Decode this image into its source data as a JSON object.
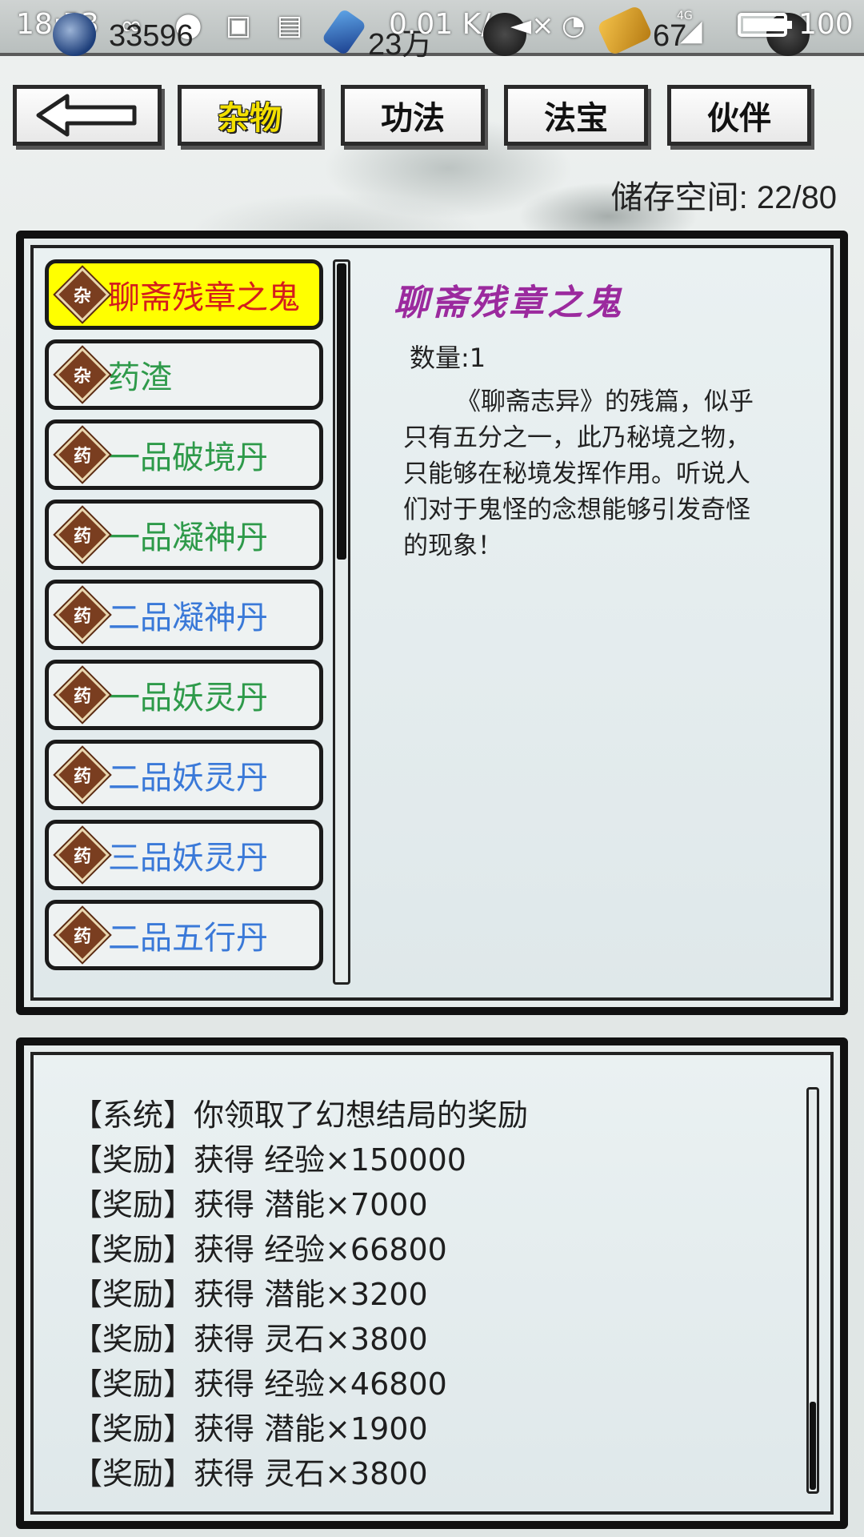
{
  "status_bar": {
    "time": "18:53",
    "speed": "0.01 K/s",
    "battery_level": "100",
    "battery_fill": 1.0,
    "network": "4G"
  },
  "resources": {
    "taiji_value": "33596",
    "crystal_value": "23万",
    "jade_value": "67"
  },
  "tabs": [
    {
      "label": "杂物",
      "active": true
    },
    {
      "label": "功法",
      "active": false
    },
    {
      "label": "法宝",
      "active": false
    },
    {
      "label": "伙伴",
      "active": false
    }
  ],
  "storage": {
    "label": "储存空间: 22/80"
  },
  "items": [
    {
      "badge": "杂",
      "name": "聊斋残章之鬼",
      "color": "#d41d1d",
      "selected": true
    },
    {
      "badge": "杂",
      "name": "药渣",
      "color": "#2e9a4a",
      "selected": false
    },
    {
      "badge": "药",
      "name": "一品破境丹",
      "color": "#2e9a4a",
      "selected": false
    },
    {
      "badge": "药",
      "name": "一品凝神丹",
      "color": "#2e9a4a",
      "selected": false
    },
    {
      "badge": "药",
      "name": "二品凝神丹",
      "color": "#3a79d8",
      "selected": false
    },
    {
      "badge": "药",
      "name": "一品妖灵丹",
      "color": "#2e9a4a",
      "selected": false
    },
    {
      "badge": "药",
      "name": "二品妖灵丹",
      "color": "#3a79d8",
      "selected": false
    },
    {
      "badge": "药",
      "name": "三品妖灵丹",
      "color": "#3a79d8",
      "selected": false
    },
    {
      "badge": "药",
      "name": "二品五行丹",
      "color": "#3a79d8",
      "selected": false
    }
  ],
  "detail": {
    "title": "聊斋残章之鬼",
    "quantity": "数量:1",
    "description": "《聊斋志异》的残篇，似乎只有五分之一，此乃秘境之物，只能够在秘境发挥作用。听说人们对于鬼怪的念想能够引发奇怪的现象！"
  },
  "log": [
    "【系统】你领取了幻想结局的奖励",
    "【奖励】获得 经验×150000",
    "【奖励】获得 潜能×7000",
    "【奖励】获得 经验×66800",
    "【奖励】获得 潜能×3200",
    "【奖励】获得 灵石×3800",
    "【奖励】获得 经验×46800",
    "【奖励】获得 潜能×1900",
    "【奖励】获得 灵石×3800"
  ],
  "colors": {
    "selected_bg": "#ffff00",
    "title_purple": "#9b2a9e",
    "active_tab_text": "#f3e000"
  }
}
